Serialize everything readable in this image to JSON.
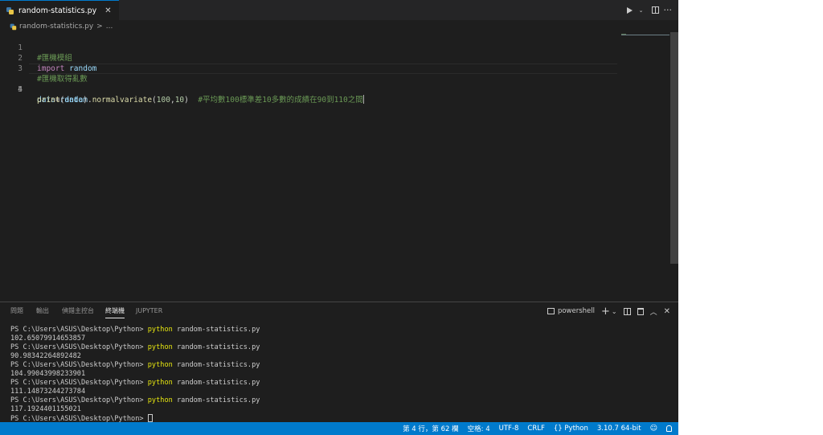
{
  "tab": {
    "filename": "random-statistics.py",
    "close_glyph": "✕"
  },
  "editor_actions": {
    "run_glyph": "▷",
    "dropdown_glyph": "⌄",
    "more_glyph": "···"
  },
  "breadcrumb": {
    "file": "random-statistics.py",
    "separator": ">",
    "rest": "..."
  },
  "code": {
    "line_numbers": [
      "1",
      "2",
      "3",
      "4",
      "5"
    ],
    "line1": {
      "comment": "#匯機模組"
    },
    "line2": {
      "keyword": "import",
      "module": "random"
    },
    "line3": {
      "comment": "#匯機取得亂數"
    },
    "line4": {
      "var": "data",
      "eq": "=",
      "module": "random",
      "dot": ".",
      "func": "normalvariate",
      "open": "(",
      "arg1": "100",
      "comma": ",",
      "arg2": "10",
      "close": ")",
      "comment": "#平均數100標準差10多數的成績在90到110之間"
    },
    "line5": {
      "func": "print",
      "open": "(",
      "arg": "data",
      "close": ")"
    }
  },
  "panel": {
    "tabs": [
      "問題",
      "輸出",
      "偵錯主控台",
      "終端機",
      "JUPYTER"
    ],
    "active_tab": "終端機",
    "shell_label": "powershell",
    "add_glyph": "+",
    "dropdown_glyph": "⌄",
    "maximize_glyph": "︿",
    "close_glyph": "✕"
  },
  "terminal": {
    "prompt": "PS C:\\Users\\ASUS\\Desktop\\Python> ",
    "cmd": "python",
    "args": " random-statistics.py",
    "outputs": [
      "102.65079914653857",
      "90.98342264892482",
      "104.99043998233901",
      "111.14873244273784",
      "117.1924401155021"
    ]
  },
  "status": {
    "position": "第 4 行，第 62 欄",
    "spaces": "空格: 4",
    "encoding": "UTF-8",
    "eol": "CRLF",
    "language": "Python",
    "interpreter": "3.10.7 64-bit"
  },
  "colors": {
    "editor_bg": "#1e1e1e",
    "statusbar_bg": "#007acc",
    "comment": "#6a9955",
    "keyword": "#c586c0",
    "function": "#dcdcaa",
    "number": "#b5cea8",
    "variable": "#9cdcfe",
    "terminal_command": "#e5e510"
  }
}
